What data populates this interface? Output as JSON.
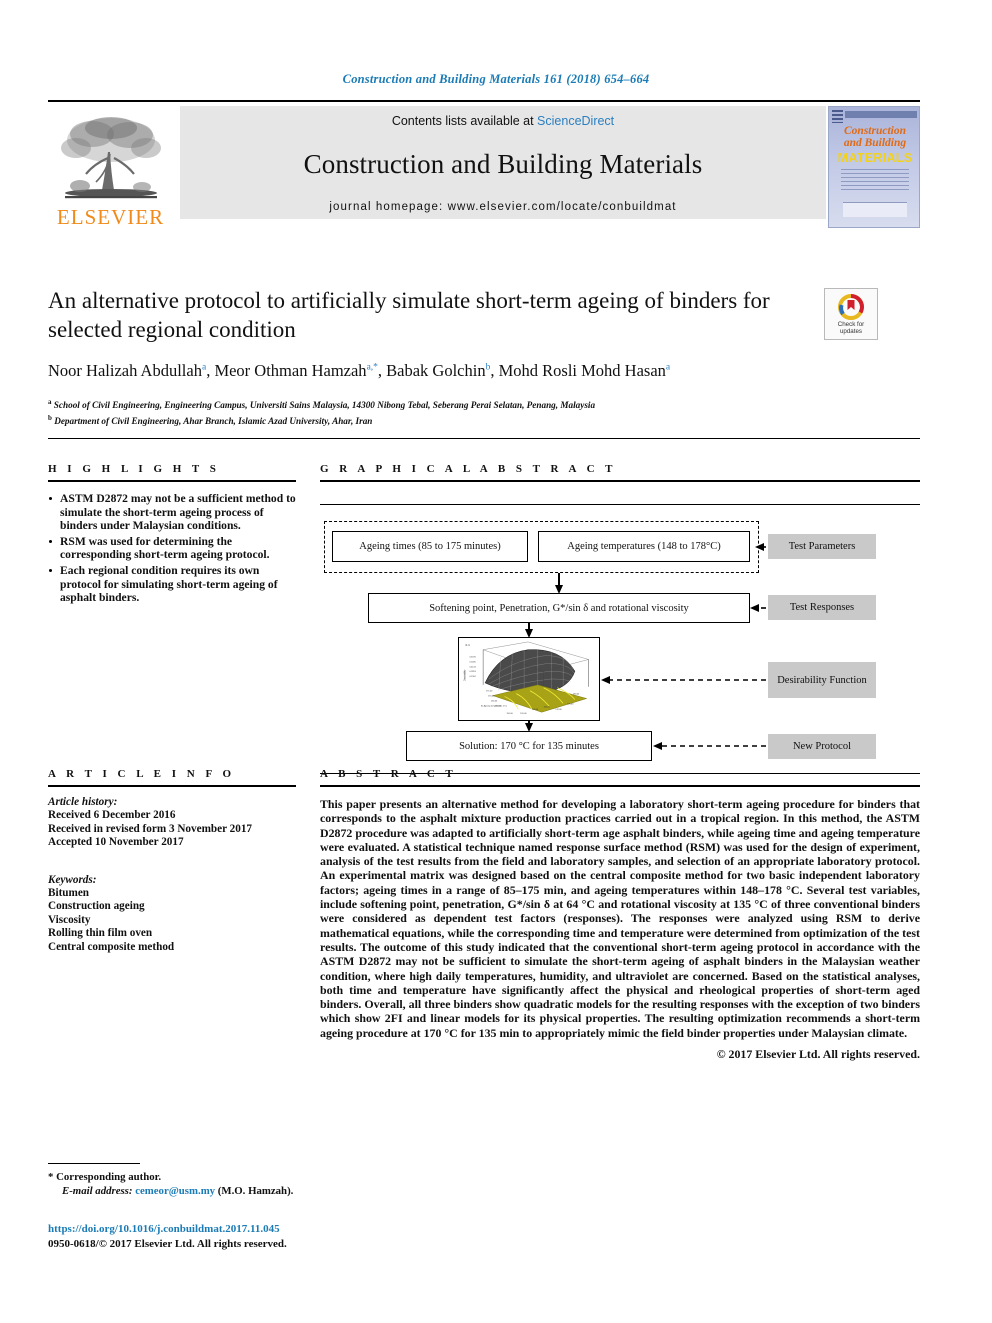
{
  "running_head": "Construction and Building Materials 161 (2018) 654–664",
  "masthead": {
    "contents_prefix": "Contents lists available at ",
    "sciencedirect": "ScienceDirect",
    "journal_title": "Construction and Building Materials",
    "homepage": "journal homepage: www.elsevier.com/locate/conbuildmat",
    "publisher": "ELSEVIER",
    "cover": {
      "line1": "Construction",
      "line2": "and Building",
      "line3": "MATERIALS"
    }
  },
  "article": {
    "title": "An alternative protocol to artificially simulate short-term ageing of binders for selected regional condition",
    "crossmark_label": "Check for updates",
    "authors_html": "Noor Halizah Abdullah<sup>a</sup>, Meor Othman Hamzah<sup>a,*</sup>, Babak Golchin<sup>b</sup>, Mohd Rosli Mohd Hasan<sup>a</sup>",
    "affiliation_a": "School of Civil Engineering, Engineering Campus, Universiti Sains Malaysia, 14300 Nibong Tebal, Seberang Perai Selatan, Penang, Malaysia",
    "affiliation_b": "Department of Civil Engineering, Ahar Branch, Islamic Azad University, Ahar, Iran"
  },
  "highlights": {
    "heading": "H I G H L I G H T S",
    "items": [
      "ASTM D2872 may not be a sufficient method to simulate the short-term ageing process of binders under Malaysian conditions.",
      "RSM was used for determining the corresponding short-term ageing protocol.",
      "Each regional condition requires its own protocol for simulating short-term ageing of asphalt binders."
    ]
  },
  "graphical_abstract": {
    "heading": "G R A P H I C A L   A B S T R A C T",
    "boxes": {
      "ageing_times": "Ageing times (85 to 175 minutes)",
      "ageing_temperatures": "Ageing temperatures (148 to 178°C)",
      "test_responses_box": "Softening point, Penetration, G*/sin δ and rotational viscosity",
      "solution": "Solution:  170 °C for 135 minutes"
    },
    "labels": {
      "test_parameters": "Test Parameters",
      "test_responses": "Test Responses",
      "desirability_function": "Desirability Function",
      "new_protocol": "New Protocol"
    }
  },
  "article_info": {
    "heading": "A R T I C L E   I N F O",
    "history_label": "Article history:",
    "received": "Received 6 December 2016",
    "revised": "Received in revised form 3 November 2017",
    "accepted": "Accepted 10 November 2017",
    "keywords_label": "Keywords:",
    "keywords": [
      "Bitumen",
      "Construction ageing",
      "Viscosity",
      "Rolling thin film oven",
      "Central composite method"
    ]
  },
  "abstract": {
    "heading": "A B S T R A C T",
    "body": "This paper presents an alternative method for developing a laboratory short-term ageing procedure for binders that corresponds to the asphalt mixture production practices carried out in a tropical region. In this method, the ASTM D2872 procedure was adapted to artificially short-term age asphalt binders, while ageing time and ageing temperature were evaluated. A statistical technique named response surface method (RSM) was used for the design of experiment, analysis of the test results from the field and laboratory samples, and selection of an appropriate laboratory protocol. An experimental matrix was designed based on the central composite method for two basic independent laboratory factors; ageing times in a range of 85–175 min, and ageing temperatures within 148–178 °C. Several test variables, include softening point, penetration, G*/sin δ at 64 °C and rotational viscosity at 135 °C of three conventional binders were considered as dependent test factors (responses). The responses were analyzed using RSM to derive mathematical equations, while the corresponding time and temperature were determined from optimization of the test results. The outcome of this study indicated that the conventional short-term ageing protocol in accordance with the ASTM D2872 may not be sufficient to simulate the short-term ageing of asphalt binders in the Malaysian weather condition, where high daily temperatures, humidity, and ultraviolet are concerned. Based on the statistical analyses, both time and temperature have significantly affect the physical and rheological properties of short-term aged binders. Overall, all three binders show quadratic models for the resulting responses with the exception of two binders which show 2FI and linear models for its physical properties. The resulting optimization recommends a short-term ageing procedure at 170 °C for 135 min to appropriately mimic the field binder properties under Malaysian climate.",
    "copyright": "© 2017 Elsevier Ltd. All rights reserved."
  },
  "footer": {
    "corresponding": "* Corresponding author.",
    "email_label": "E-mail address:",
    "email": "cemeor@usm.my",
    "email_suffix": "(M.O. Hamzah).",
    "doi": "https://doi.org/10.1016/j.conbuildmat.2017.11.045",
    "issn_line": "0950-0618/© 2017 Elsevier Ltd. All rights reserved."
  },
  "colors": {
    "link_blue": "#1a7bb5",
    "elsevier_orange": "#f08a1b",
    "banner_grey": "#e6e6e6",
    "label_grey": "#c9c9c9",
    "plot_olive": "#a8a216"
  }
}
